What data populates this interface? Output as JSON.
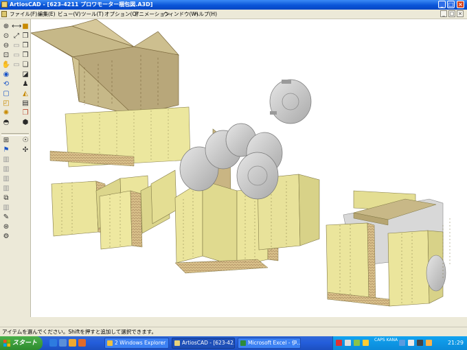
{
  "window": {
    "title": "ArtiosCAD - [623-4211 プロワモーター梱包図.A3D]",
    "min_glyph": "_",
    "max_glyph": "□",
    "close_glyph": "×"
  },
  "menu": {
    "items": [
      "ファイル(F)",
      "編集(E)",
      "ビュー(V)",
      "ツール(T)",
      "オプション(O)",
      "アニメーション",
      "ウィンドウ(W)",
      "ヘルプ(H)"
    ],
    "mdi_min": "_",
    "mdi_max": "□",
    "mdi_close": "×"
  },
  "toolbar": {
    "icons": [
      "zoom-in-icon",
      "fit-width-icon",
      "zoom-out-icon",
      "zoom-window-icon",
      "zoom-extents-icon",
      "pan-hand-icon",
      "rotate-view-icon",
      "eye-view-icon",
      "perspective-icon",
      "rotate-3d-icon",
      "front-view-icon",
      "top-view-icon",
      "box-view-icon",
      "side-view-icon",
      "iso-view-icon",
      "fold-icon",
      "solid-view-icon",
      "shaded-icon",
      "wireframe-icon",
      "light-icon",
      "render-icon",
      "texture-icon"
    ]
  },
  "statusbar": {
    "message": "アイテムを選んでください。Shiftを押すと追加して選択できます。"
  },
  "taskbar": {
    "start_label": "スタート",
    "tasks": [
      {
        "label": "2 Windows Explorer",
        "active": false
      },
      {
        "label": "ArtiosCAD - [623-42...",
        "active": true
      },
      {
        "label": "Microsoft Excel - 伊...",
        "active": false
      }
    ],
    "ime_label": "CAPS KANA",
    "clock": "21:29"
  },
  "colors": {
    "board": "#e8e39a",
    "board_side": "#d6cf84",
    "corrugated_edge": "#c9a36a",
    "box_kraft": "#c8b98a",
    "motor": "#c4c4c4",
    "titlebar": "#0a55d8",
    "chrome": "#ece9d8"
  }
}
